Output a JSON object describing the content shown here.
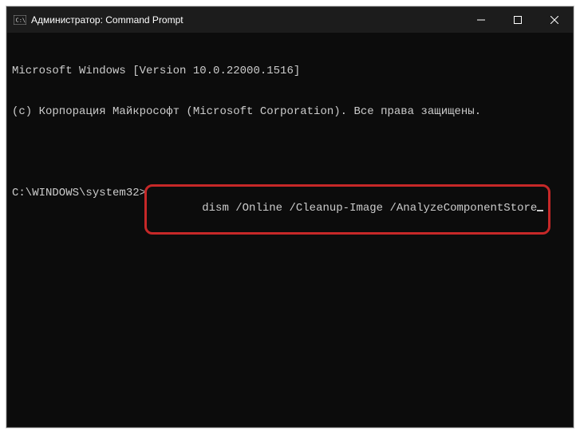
{
  "titlebar": {
    "title": "Администратор: Command Prompt"
  },
  "terminal": {
    "line1": "Microsoft Windows [Version 10.0.22000.1516]",
    "line2": "(c) Корпорация Майкрософт (Microsoft Corporation). Все права защищены.",
    "prompt": "C:\\WINDOWS\\system32>",
    "command": "dism /Online /Cleanup-Image /AnalyzeComponentStore"
  }
}
